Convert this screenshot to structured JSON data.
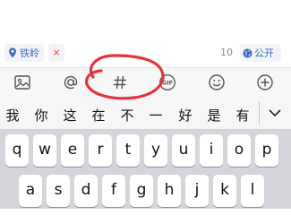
{
  "info_bar": {
    "location_label": "铁岭",
    "remove_symbol": "×",
    "char_count": "10",
    "visibility_label": "公开"
  },
  "toolbar": {
    "icons": [
      "image-icon",
      "at-icon",
      "hashtag-icon",
      "gif-icon",
      "emoji-icon",
      "add-icon"
    ]
  },
  "keyboard": {
    "candidates": [
      "我",
      "你",
      "这",
      "在",
      "不",
      "一",
      "好",
      "是",
      "有"
    ],
    "row1": [
      "q",
      "w",
      "e",
      "r",
      "t",
      "y",
      "u",
      "i",
      "o",
      "p"
    ],
    "row2": [
      "a",
      "s",
      "d",
      "f",
      "g",
      "h",
      "j",
      "k",
      "l"
    ]
  },
  "colors": {
    "accent": "#3d6db8",
    "annotation": "#e3343d",
    "keyboard_bg": "#d3d5db"
  }
}
